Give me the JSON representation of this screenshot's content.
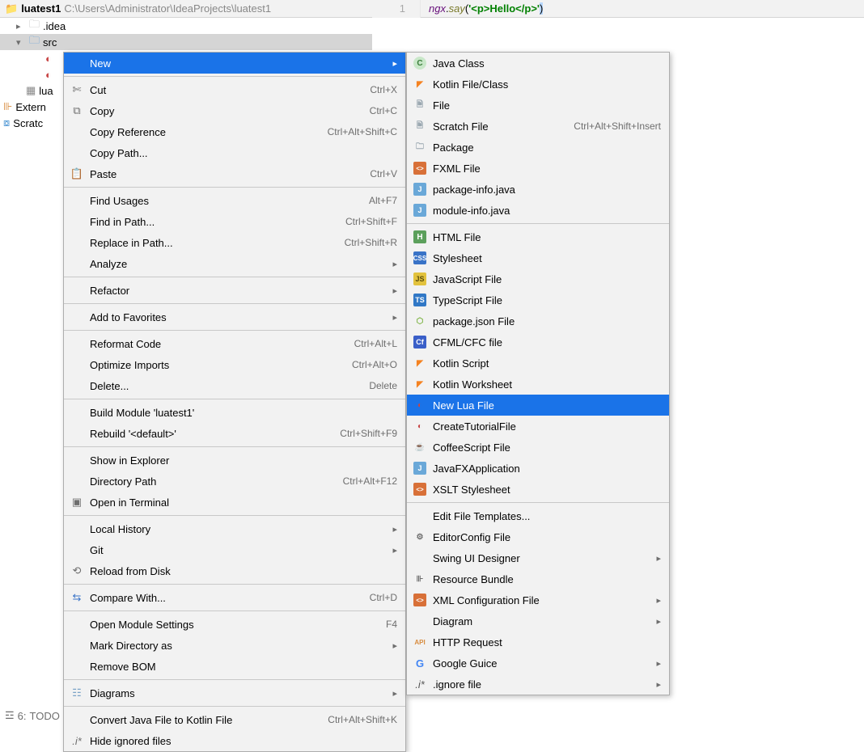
{
  "breadcrumb": {
    "project": "luatest1",
    "path": "C:\\Users\\Administrator\\IdeaProjects\\luatest1"
  },
  "editor": {
    "lineno": "1",
    "ident": "ngx",
    "fn": "say",
    "str": "'<p>Hello</p>'"
  },
  "tree": {
    "idea": ".idea",
    "src": "src",
    "lua": "lua",
    "extern": "Extern",
    "scratc": "Scratc"
  },
  "menu1": {
    "new": "New",
    "cut": "Cut",
    "cut_s": "Ctrl+X",
    "copy": "Copy",
    "copy_s": "Ctrl+C",
    "copyref": "Copy Reference",
    "copyref_s": "Ctrl+Alt+Shift+C",
    "copypath": "Copy Path...",
    "paste": "Paste",
    "paste_s": "Ctrl+V",
    "findusages": "Find Usages",
    "findusages_s": "Alt+F7",
    "findinpath": "Find in Path...",
    "findinpath_s": "Ctrl+Shift+F",
    "replaceinpath": "Replace in Path...",
    "replaceinpath_s": "Ctrl+Shift+R",
    "analyze": "Analyze",
    "refactor": "Refactor",
    "addfav": "Add to Favorites",
    "reformat": "Reformat Code",
    "reformat_s": "Ctrl+Alt+L",
    "optimize": "Optimize Imports",
    "optimize_s": "Ctrl+Alt+O",
    "delete": "Delete...",
    "delete_s": "Delete",
    "buildmod": "Build Module 'luatest1'",
    "rebuild": "Rebuild '<default>'",
    "rebuild_s": "Ctrl+Shift+F9",
    "showexpl": "Show in Explorer",
    "dirpath": "Directory Path",
    "dirpath_s": "Ctrl+Alt+F12",
    "openterm": "Open in Terminal",
    "localhist": "Local History",
    "git": "Git",
    "reload": "Reload from Disk",
    "compare": "Compare With...",
    "compare_s": "Ctrl+D",
    "openmod": "Open Module Settings",
    "openmod_s": "F4",
    "markdir": "Mark Directory as",
    "removebom": "Remove BOM",
    "diagrams": "Diagrams",
    "convertk": "Convert Java File to Kotlin File",
    "convertk_s": "Ctrl+Alt+Shift+K",
    "hideign": "Hide ignored files"
  },
  "menu2": {
    "javaclass": "Java Class",
    "kotlinfc": "Kotlin File/Class",
    "file": "File",
    "scratch": "Scratch File",
    "scratch_s": "Ctrl+Alt+Shift+Insert",
    "package": "Package",
    "fxml": "FXML File",
    "pkginfo": "package-info.java",
    "modinfo": "module-info.java",
    "html": "HTML File",
    "stylesheet": "Stylesheet",
    "jsfile": "JavaScript File",
    "tsfile": "TypeScript File",
    "pkgjson": "package.json File",
    "cfml": "CFML/CFC file",
    "kscript": "Kotlin Script",
    "kworksheet": "Kotlin Worksheet",
    "newlua": "New Lua File",
    "tutorial": "CreateTutorialFile",
    "coffee": "CoffeeScript File",
    "javafx": "JavaFXApplication",
    "xslt": "XSLT Stylesheet",
    "editft": "Edit File Templates...",
    "editorcfg": "EditorConfig File",
    "swingui": "Swing UI Designer",
    "resbundle": "Resource Bundle",
    "xmlcfg": "XML Configuration File",
    "diagram": "Diagram",
    "httpreq": "HTTP Request",
    "guice": "Google Guice",
    "ignore": ".ignore file"
  },
  "bottom": {
    "todo_num": "6:",
    "todo": "TODO"
  }
}
